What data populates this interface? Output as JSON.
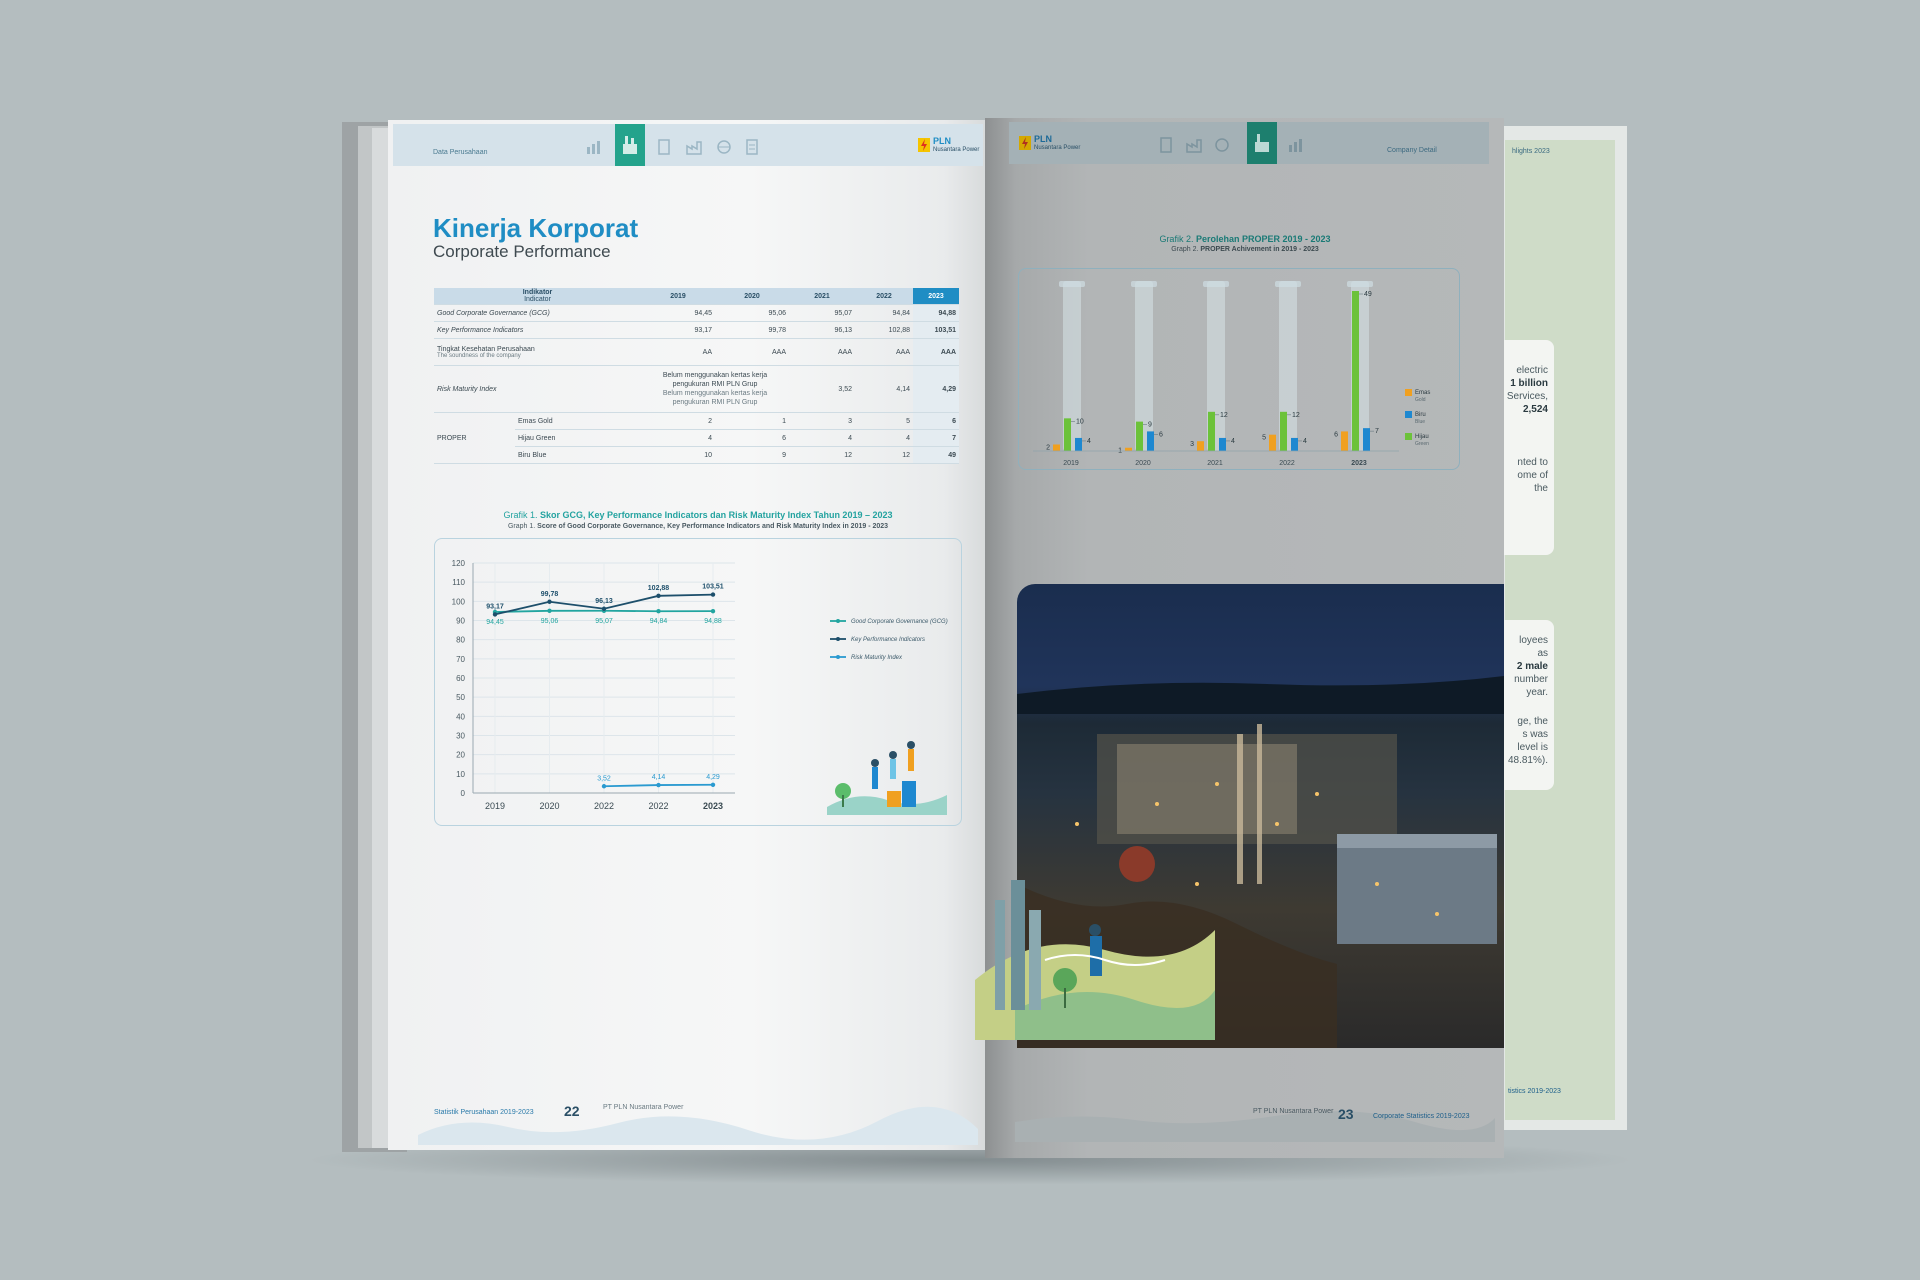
{
  "left_page": {
    "header": {
      "section": "Data Perusahaan",
      "logo_line1": "PLN",
      "logo_line2": "Nusantara Power"
    },
    "title": "Kinerja Korporat",
    "subtitle": "Corporate Performance",
    "table": {
      "header_label": "Indikator",
      "header_sub": "Indicator",
      "years": [
        "2019",
        "2020",
        "2021",
        "2022",
        "2023"
      ],
      "rows": {
        "gcg": {
          "label": "Good Corporate Governance (GCG)",
          "values": [
            "94,45",
            "95,06",
            "95,07",
            "94,84",
            "94,88"
          ]
        },
        "kpi": {
          "label": "Key Performance Indicators",
          "values": [
            "93,17",
            "99,78",
            "96,13",
            "102,88",
            "103,51"
          ]
        },
        "tkp": {
          "label": "Tingkat Kesehatan Perusahaan",
          "sub": "The soundness of the company",
          "values": [
            "AA",
            "AAA",
            "AAA",
            "AAA",
            "AAA"
          ]
        },
        "rmi": {
          "label": "Risk Maturity Index",
          "note_id": "Belum menggunakan kertas kerja pengukuran RMI PLN Grup",
          "note_en": "Belum menggunakan kertas kerja pengukuran RMI PLN Grup",
          "values": [
            "3,52",
            "4,14",
            "4,29"
          ]
        },
        "proper_label": "PROPER",
        "emas": {
          "label": "Emas Gold",
          "values": [
            "2",
            "1",
            "3",
            "5",
            "6"
          ]
        },
        "hijau": {
          "label": "Hijau Green",
          "values": [
            "4",
            "6",
            "4",
            "4",
            "7"
          ]
        },
        "biru": {
          "label": "Biru Blue",
          "values": [
            "10",
            "9",
            "12",
            "12",
            "49"
          ]
        }
      }
    },
    "graph1": {
      "title_prefix": "Grafik 1.",
      "title": "Skor GCG, Key Performance Indicators dan Risk Maturity Index Tahun 2019 – 2023",
      "subtitle_prefix": "Graph 1.",
      "subtitle": "Score of Good Corporate Governance, Key Performance Indicators and Risk Maturity Index in 2019 - 2023"
    },
    "footer": {
      "left": "Statistik Perusahaan 2019-2023",
      "page": "22",
      "company": "PT PLN Nusantara Power"
    }
  },
  "right_page": {
    "header": {
      "logo_line1": "PLN",
      "logo_line2": "Nusantara Power",
      "section": "Company Detail",
      "next_section": "hlights 2023"
    },
    "graph2": {
      "title_prefix": "Grafik 2.",
      "title": "Perolehan PROPER 2019 - 2023",
      "subtitle_prefix": "Graph 2.",
      "subtitle": "PROPER Achivement in 2019 - 2023"
    },
    "footer": {
      "company": "PT PLN Nusantara Power",
      "page": "23",
      "right": "Corporate Statistics 2019-2023",
      "next_right": "tistics 2019-2023"
    },
    "next_page_fragments": [
      "electric",
      "1 billion",
      "Services,",
      "2,524",
      "nted to",
      "ome of",
      "the",
      "loyees",
      "as",
      "2 male",
      "number",
      "year.",
      "ge, the",
      "s was",
      "level is",
      "48.81%)."
    ]
  },
  "chart_data": [
    {
      "type": "line",
      "title": "Skor GCG, Key Performance Indicators dan Risk Maturity Index Tahun 2019 – 2023",
      "x": [
        "2019",
        "2020",
        "2022",
        "2022",
        "2023"
      ],
      "ylim": [
        0,
        120
      ],
      "yticks": [
        0,
        10,
        20,
        30,
        40,
        50,
        60,
        70,
        80,
        90,
        100,
        110,
        120
      ],
      "legend_position": "right",
      "series": [
        {
          "name": "Good Corporate Governance (GCG)",
          "values": [
            94.45,
            95.06,
            95.07,
            94.84,
            94.88
          ],
          "labels": [
            "94,45",
            "95,06",
            "95,07",
            "94,84",
            "94,88"
          ],
          "color": "#22a5a0"
        },
        {
          "name": "Key Performance Indicators",
          "values": [
            93.17,
            99.78,
            96.13,
            102.88,
            103.51
          ],
          "labels": [
            "93,17",
            "99,78",
            "96,13",
            "102,88",
            "103,51"
          ],
          "color": "#1d4f6b"
        },
        {
          "name": "Risk Maturity Index",
          "values": [
            null,
            null,
            3.52,
            4.14,
            4.29
          ],
          "labels": [
            "",
            "",
            "3,52",
            "4,14",
            "4,29"
          ],
          "color": "#2a9ad0"
        }
      ]
    },
    {
      "type": "bar",
      "title": "Perolehan PROPER 2019 - 2023",
      "categories": [
        "2019",
        "2020",
        "2021",
        "2022",
        "2023"
      ],
      "ylim": [
        0,
        49
      ],
      "legend_position": "right",
      "series": [
        {
          "name": "Emas Gold",
          "legend_line1": "Emas",
          "legend_line2": "Gold",
          "values": [
            2,
            1,
            3,
            5,
            6
          ],
          "color": "#f0a020"
        },
        {
          "name": "Hijau Green",
          "legend_line1": "Hijau",
          "legend_line2": "Green",
          "values": [
            10,
            9,
            12,
            12,
            49
          ],
          "color": "#6cc23a"
        },
        {
          "name": "Biru Blue",
          "legend_line1": "Biru",
          "legend_line2": "Blue",
          "values": [
            4,
            6,
            4,
            4,
            7
          ],
          "color": "#1e88d0"
        }
      ]
    }
  ]
}
